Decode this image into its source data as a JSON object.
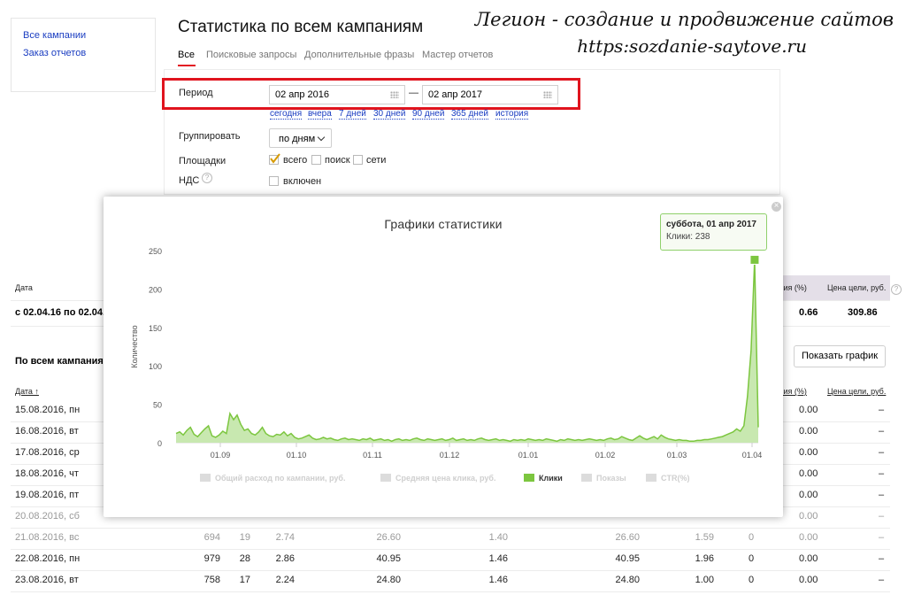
{
  "nav": {
    "items": [
      "Все кампании",
      "Заказ отчетов"
    ]
  },
  "page": {
    "title": "Статистика по всем кампаниям",
    "tabs": [
      "Все",
      "Поисковые запросы",
      "Дополнительные фразы",
      "Мастер отчетов"
    ]
  },
  "brand": {
    "line1": "Легион - создание и продвижение сайтов",
    "line2": "https:sozdanie-saytove.ru"
  },
  "filters": {
    "period_label": "Период",
    "date_from": "02 апр 2016",
    "date_dash": "—",
    "date_to": "02 апр 2017",
    "quick_links": [
      "сегодня",
      "вчера",
      "7 дней",
      "30 дней",
      "90 дней",
      "365 дней",
      "история"
    ],
    "group_label": "Группировать",
    "group_value": "по дням",
    "sites_label": "Площадки",
    "sites_options": [
      {
        "label": "всего",
        "checked": true
      },
      {
        "label": "поиск",
        "checked": false
      },
      {
        "label": "сети",
        "checked": false
      }
    ],
    "vat_label": "НДС",
    "vat_help": "?",
    "vat_option": "включен"
  },
  "summary": {
    "date_header": "Дата",
    "conv_header": "рсия (%)",
    "goal_price_header": "Цена цели, руб.",
    "help": "?",
    "period_value": "с 02.04.16 по 02.04.",
    "conv_value": "0.66",
    "goal_price_value": "309.86"
  },
  "daily": {
    "section_title": "По всем кампаниям",
    "date_header": "Дата ↑",
    "conv_header": "рсия (%)",
    "goal_price_header": "Цена цели, руб.",
    "show_chart_button": "Показать график",
    "rows": [
      {
        "date": "15.08.2016, пн",
        "cols": [
          "",
          "",
          "",
          "",
          "",
          "",
          ""
        ],
        "conv": "0.00",
        "price": "–",
        "weekend": false
      },
      {
        "date": "16.08.2016, вт",
        "cols": [
          "",
          "",
          "",
          "",
          "",
          "",
          ""
        ],
        "conv": "0.00",
        "price": "–",
        "weekend": false
      },
      {
        "date": "17.08.2016, ср",
        "cols": [
          "",
          "",
          "",
          "",
          "",
          "",
          ""
        ],
        "conv": "0.00",
        "price": "–",
        "weekend": false
      },
      {
        "date": "18.08.2016, чт",
        "cols": [
          "",
          "",
          "",
          "",
          "",
          "",
          ""
        ],
        "conv": "0.00",
        "price": "–",
        "weekend": false
      },
      {
        "date": "19.08.2016, пт",
        "cols": [
          "",
          "",
          "",
          "",
          "",
          "",
          ""
        ],
        "conv": "0.00",
        "price": "–",
        "weekend": false
      },
      {
        "date": "20.08.2016, сб",
        "cols": [
          "",
          "",
          "",
          "",
          "",
          "",
          ""
        ],
        "conv": "0.00",
        "price": "–",
        "weekend": true
      },
      {
        "date": "21.08.2016, вс",
        "cols": [
          "694",
          "19",
          "2.74",
          "26.60",
          "1.40",
          "26.60",
          "1.59"
        ],
        "zero": "0",
        "conv": "0.00",
        "price": "–",
        "weekend": true
      },
      {
        "date": "22.08.2016, пн",
        "cols": [
          "979",
          "28",
          "2.86",
          "40.95",
          "1.46",
          "40.95",
          "1.96"
        ],
        "zero": "0",
        "conv": "0.00",
        "price": "–",
        "weekend": false
      },
      {
        "date": "23.08.2016, вт",
        "cols": [
          "758",
          "17",
          "2.24",
          "24.80",
          "1.46",
          "24.80",
          "1.00"
        ],
        "zero": "0",
        "conv": "0.00",
        "price": "–",
        "weekend": false
      }
    ]
  },
  "chart_popup": {
    "close_glyph": "×",
    "tooltip_title": "суббота, 01 апр 2017",
    "tooltip_value": "Клики: 238",
    "legend": [
      {
        "label": "Общий расход по кампании, руб.",
        "active": false
      },
      {
        "label": "Средняя цена клика, руб.",
        "active": false
      },
      {
        "label": "Клики",
        "active": true
      },
      {
        "label": "Показы",
        "active": false
      },
      {
        "label": "CTR(%)",
        "active": false
      }
    ],
    "colors": {
      "series": "#7cc63f",
      "fill": "#c8e8b0",
      "inactive": "#d6d6d6"
    }
  },
  "chart_data": {
    "type": "area",
    "title": "Графики статистики",
    "ylabel": "Количество",
    "ylim": [
      0,
      250
    ],
    "yticks": [
      0,
      50,
      100,
      150,
      200,
      250
    ],
    "xticks": [
      "01.09",
      "01.10",
      "01.11",
      "01.12",
      "01.01",
      "01.02",
      "01.03",
      "01.04"
    ],
    "series": [
      {
        "name": "Клики",
        "values": [
          12,
          14,
          10,
          16,
          20,
          11,
          8,
          13,
          18,
          22,
          9,
          7,
          10,
          15,
          12,
          38,
          30,
          36,
          24,
          16,
          18,
          12,
          10,
          14,
          20,
          12,
          9,
          8,
          11,
          10,
          14,
          9,
          12,
          7,
          5,
          6,
          8,
          10,
          6,
          4,
          5,
          7,
          5,
          6,
          4,
          3,
          5,
          6,
          4,
          5,
          4,
          3,
          5,
          4,
          6,
          3,
          4,
          5,
          3,
          4,
          2,
          4,
          5,
          3,
          4,
          3,
          5,
          6,
          4,
          3,
          5,
          4,
          3,
          4,
          5,
          3,
          4,
          6,
          3,
          4,
          5,
          3,
          4,
          3,
          5,
          6,
          4,
          3,
          4,
          5,
          3,
          4,
          3,
          2,
          4,
          3,
          4,
          3,
          5,
          4,
          3,
          4,
          3,
          5,
          4,
          3,
          2,
          4,
          3,
          5,
          4,
          3,
          4,
          3,
          4,
          5,
          4,
          3,
          4,
          3,
          5,
          6,
          4,
          5,
          8,
          6,
          4,
          3,
          6,
          9,
          6,
          4,
          6,
          8,
          5,
          10,
          7,
          5,
          4,
          3,
          4,
          3,
          3,
          2,
          2,
          3,
          3,
          4,
          4,
          5,
          6,
          7,
          8,
          10,
          12,
          14,
          18,
          15,
          22,
          60,
          120,
          238,
          20
        ]
      }
    ]
  }
}
